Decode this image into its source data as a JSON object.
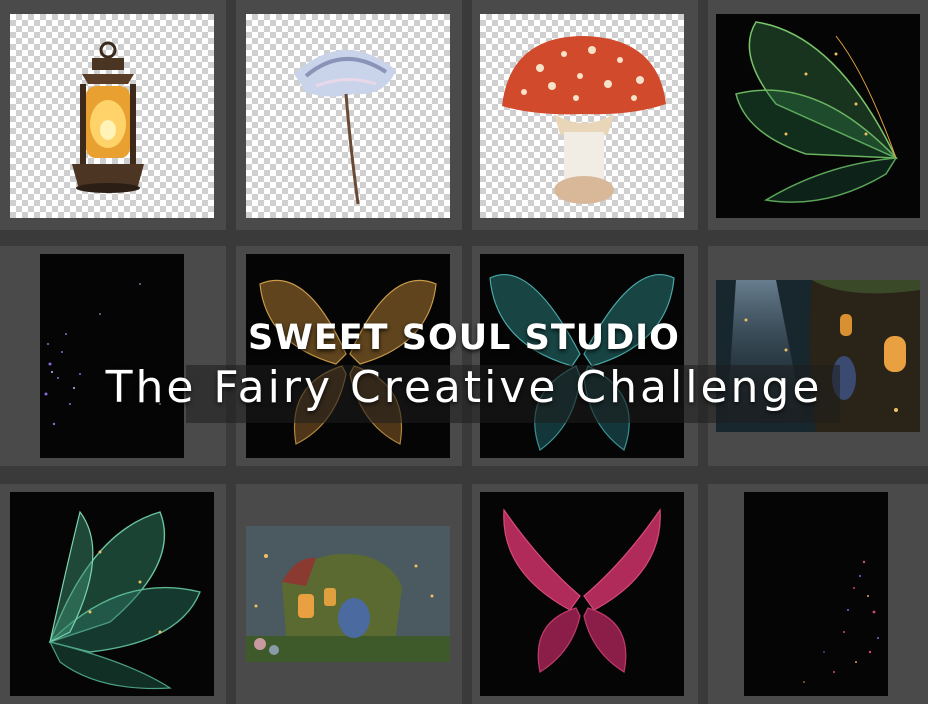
{
  "overlay": {
    "studio_title": "SWEET SOUL STUDIO",
    "challenge_title": "The Fairy Creative Challenge"
  },
  "assets": [
    {
      "name": "lantern",
      "background": "transparent"
    },
    {
      "name": "dandelion-umbrella",
      "background": "transparent"
    },
    {
      "name": "red-mushroom",
      "background": "transparent"
    },
    {
      "name": "green-fairy-wing-side",
      "background": "black"
    },
    {
      "name": "sparkle-dust-left",
      "background": "black"
    },
    {
      "name": "golden-butterfly-wings",
      "background": "black"
    },
    {
      "name": "teal-butterfly-wings",
      "background": "black"
    },
    {
      "name": "fairy-tree-house",
      "background": "photo"
    },
    {
      "name": "emerald-fairy-wing-side",
      "background": "black"
    },
    {
      "name": "moss-fairy-cottage",
      "background": "photo"
    },
    {
      "name": "magenta-butterfly-wings",
      "background": "black"
    },
    {
      "name": "sparkle-dust-right",
      "background": "black"
    }
  ],
  "colors": {
    "panel_bg": "#3a3a3a",
    "cell_bg": "#4a4a4a",
    "title_text": "#ffffff"
  }
}
